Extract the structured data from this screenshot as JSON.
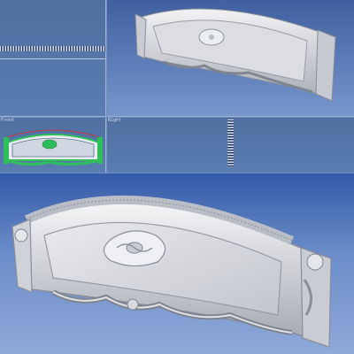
{
  "viewports": {
    "top_left": {
      "label": "",
      "model": "headboard-top-view"
    },
    "top_right": {
      "label": "",
      "model": "headboard-perspective"
    },
    "mid_left": {
      "label": "Front",
      "model": "headboard-wireframe-front"
    },
    "mid_right": {
      "label": "Right",
      "model": "headboard-side-section"
    },
    "bottom": {
      "label": "",
      "model": "headboard-render"
    }
  },
  "colors": {
    "viewport_bg": "#5a7eb2",
    "perspective_bg": "#355aa8",
    "model_surface": "#d9d9dd",
    "wire_green": "#2fbf5a"
  }
}
